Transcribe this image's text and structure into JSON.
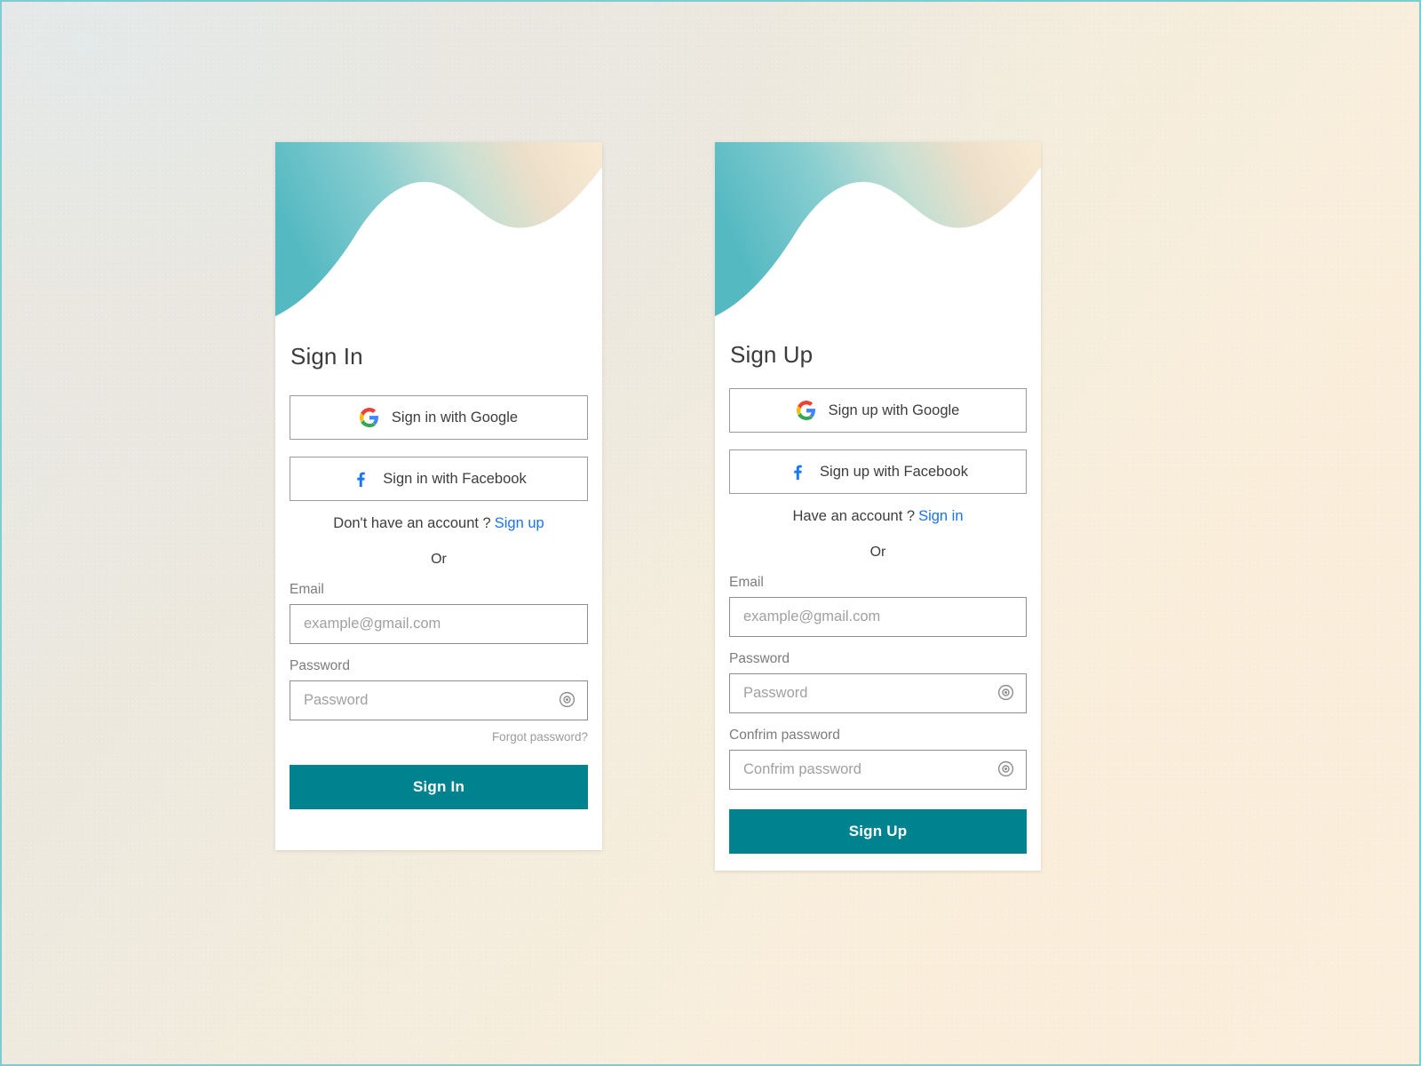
{
  "theme": {
    "accent_teal": "#00838f",
    "wave_teal": "#5cbfc6",
    "wave_cream": "#f7e8cf",
    "link_blue": "#1a73e8",
    "card_bg": "#ffffff",
    "page_border": "#7ecdd3"
  },
  "signin": {
    "title": "Sign In",
    "google_button": "Sign in with Google",
    "facebook_button": "Sign in with Facebook",
    "switch_prompt": "Don't have an account ?",
    "switch_link": "Sign up",
    "or": "Or",
    "email_label": "Email",
    "email_placeholder": "example@gmail.com",
    "email_value": "",
    "password_label": "Password",
    "password_placeholder": "Password",
    "password_value": "",
    "forgot_link": "Forgot password?",
    "submit": "Sign In"
  },
  "signup": {
    "title": "Sign Up",
    "google_button": "Sign up with Google",
    "facebook_button": "Sign up with Facebook",
    "switch_prompt": "Have an account ?",
    "switch_link": "Sign in",
    "or": "Or",
    "email_label": "Email",
    "email_placeholder": "example@gmail.com",
    "email_value": "",
    "password_label": "Password",
    "password_placeholder": "Password",
    "password_value": "",
    "confirm_label": "Confrim password",
    "confirm_placeholder": "Confrim password",
    "confirm_value": "",
    "submit": "Sign Up"
  },
  "icons": {
    "google": "google-logo-icon",
    "facebook": "facebook-logo-icon",
    "eye": "eye-toggle-icon"
  }
}
